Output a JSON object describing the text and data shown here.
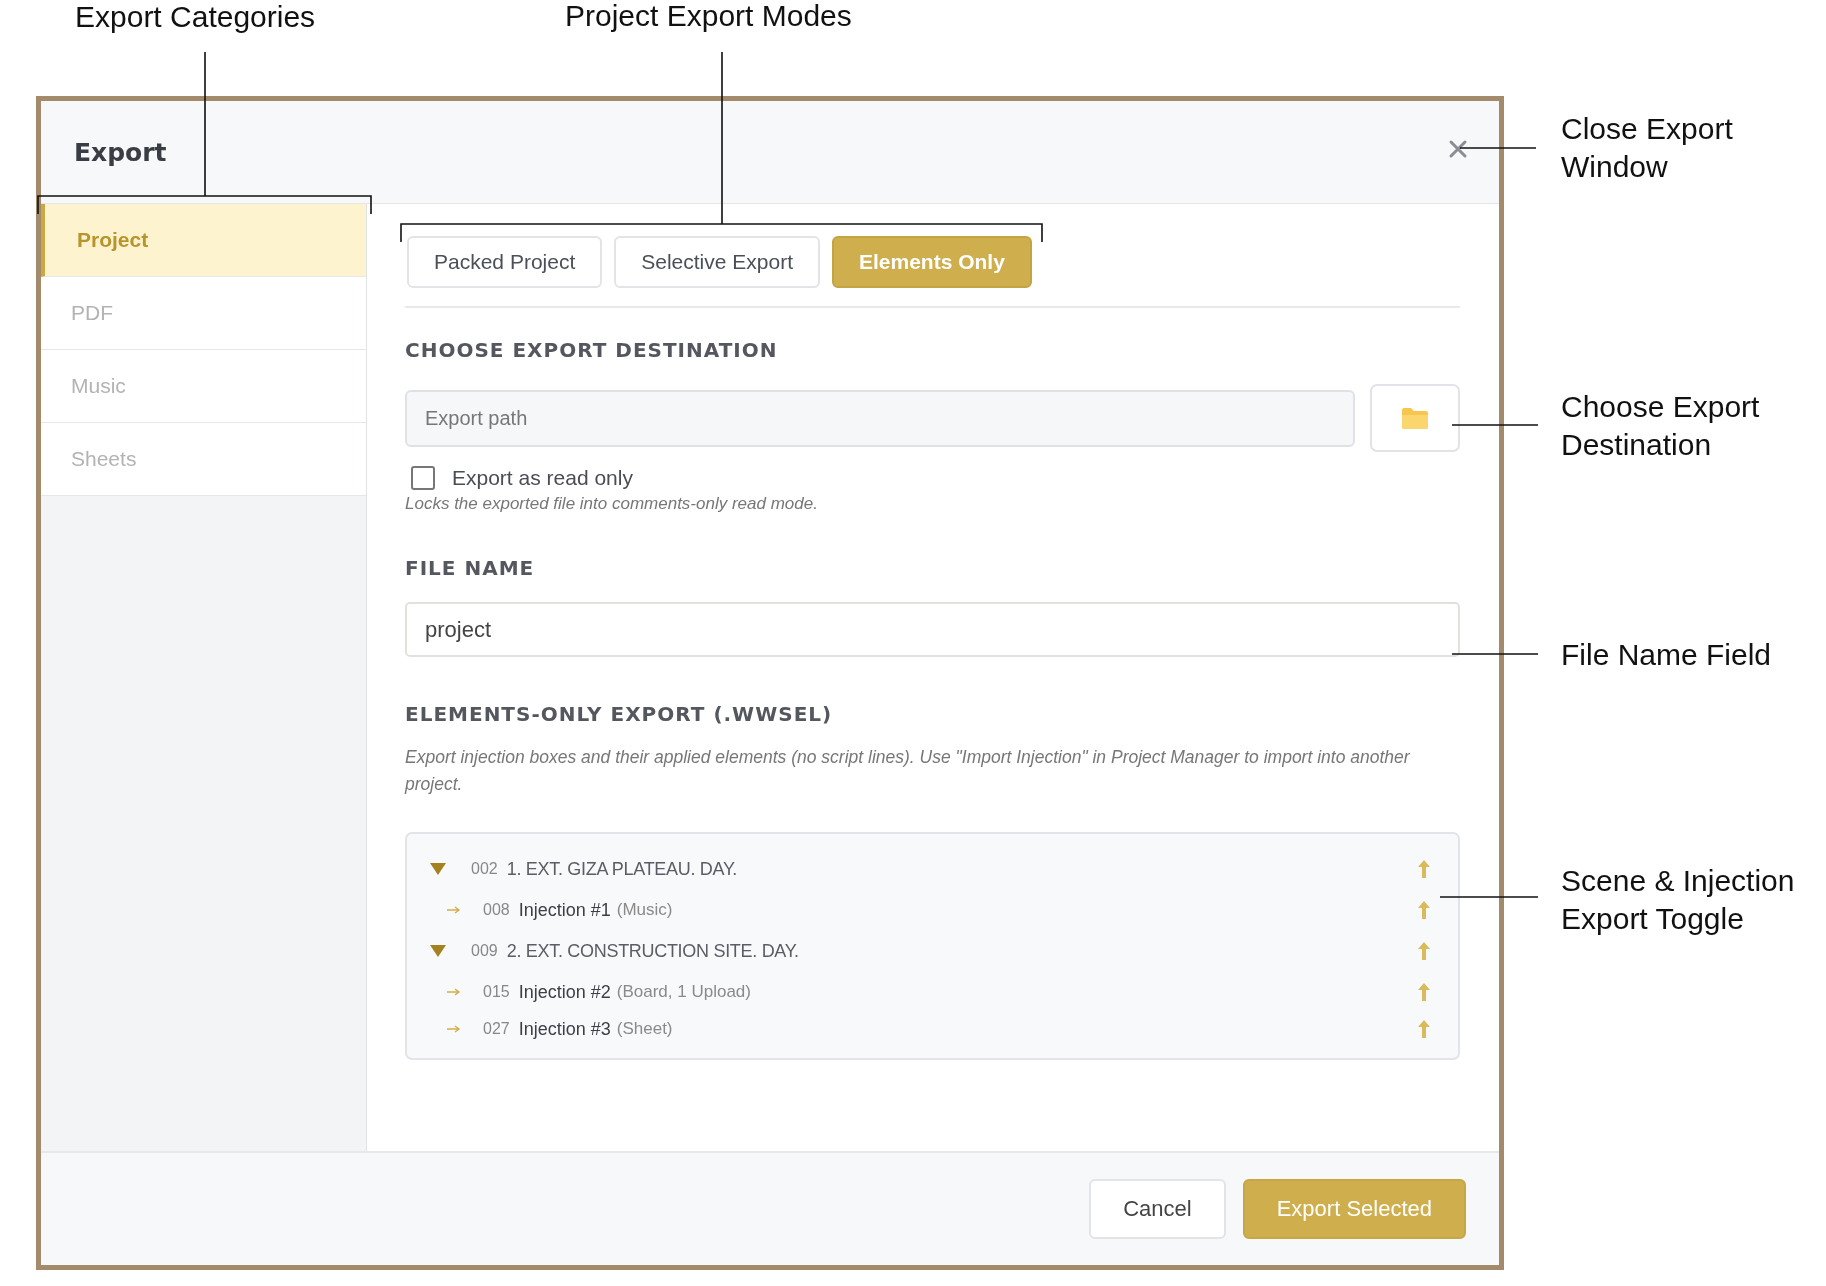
{
  "annotations": [
    {
      "text": "Export Categories"
    },
    {
      "text": "Project Export Modes"
    },
    {
      "text": "Close Export Window"
    },
    {
      "text": "Choose Export Destination"
    },
    {
      "text": "File Name Field"
    },
    {
      "text": "Scene & Injection Export Toggle"
    }
  ],
  "dialog": {
    "title": "Export",
    "categories": [
      {
        "label": "Project",
        "selected": true
      },
      {
        "label": "PDF",
        "selected": false
      },
      {
        "label": "Music",
        "selected": false
      },
      {
        "label": "Sheets",
        "selected": false
      }
    ],
    "modes": [
      {
        "label": "Packed Project",
        "selected": false
      },
      {
        "label": "Selective Export",
        "selected": false
      },
      {
        "label": "Elements Only",
        "selected": true
      }
    ],
    "destination": {
      "heading": "CHOOSE EXPORT DESTINATION",
      "placeholder": "Export path"
    },
    "read_only": {
      "label": "Export as read only",
      "checked": false,
      "hint": "Locks the exported file into comments-only read mode."
    },
    "file_name": {
      "heading": "FILE NAME",
      "value": "project"
    },
    "elements": {
      "heading": "ELEMENTS-ONLY EXPORT (.WWSEL)",
      "description": "Export injection boxes and their applied elements (no script lines). Use \"Import Injection\" in Project Manager to import into another project.",
      "tree": [
        {
          "number": "002",
          "title": "1. EXT. GIZA PLATEAU. DAY.",
          "expanded": true,
          "children": [
            {
              "number": "008",
              "name": "Injection #1",
              "detail": "(Music)"
            }
          ]
        },
        {
          "number": "009",
          "title": "2. EXT. CONSTRUCTION SITE. DAY.",
          "expanded": true,
          "children": [
            {
              "number": "015",
              "name": "Injection #2",
              "detail": "(Board, 1 Upload)"
            },
            {
              "number": "027",
              "name": "Injection #3",
              "detail": "(Sheet)"
            }
          ]
        }
      ]
    },
    "buttons": [
      {
        "label": "Cancel",
        "kind": "secondary"
      },
      {
        "label": "Export Selected",
        "kind": "primary"
      }
    ]
  }
}
